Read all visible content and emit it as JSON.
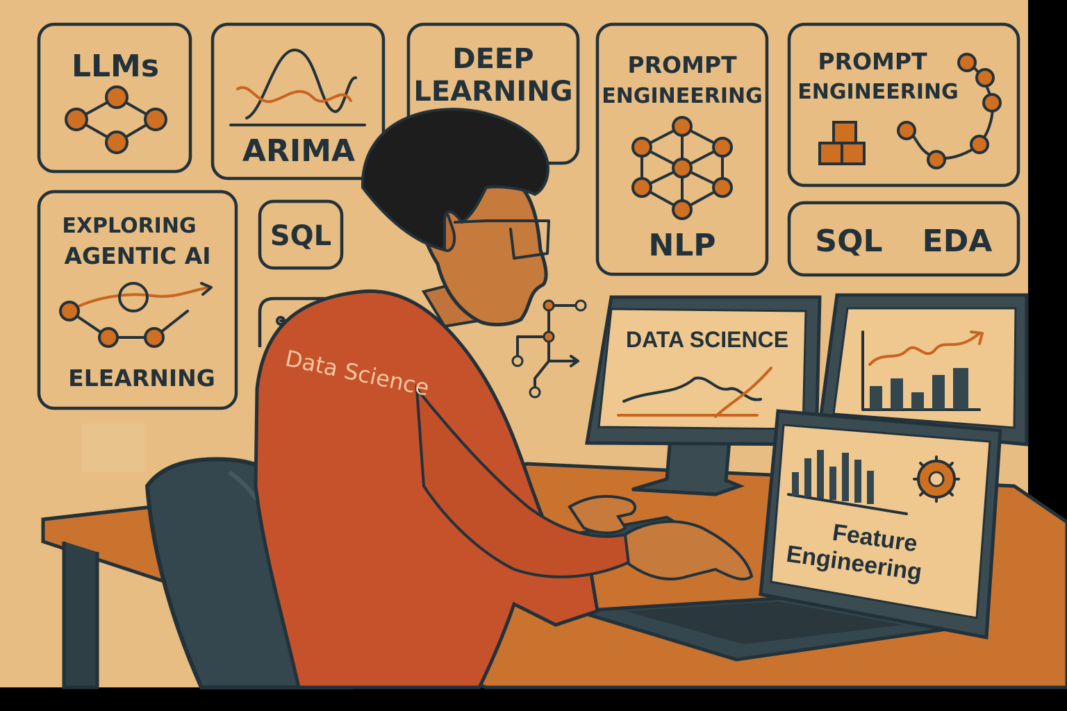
{
  "cards": {
    "llms": "LLMs",
    "arima": "ARIMA",
    "deep_learning_1": "DEEP",
    "deep_learning_2": "LEARNING",
    "prompt_eng_a_1": "PROMPT",
    "prompt_eng_a_2": "ENGINEERING",
    "nlp": "NLP",
    "prompt_eng_b_1": "PROMPT",
    "prompt_eng_b_2": "ENGINEERING",
    "exploring_1": "EXPLORING",
    "exploring_2": "AGENTIC AI",
    "elearning": "ELEARNING",
    "sql_small": "SQL",
    "sql_eda_1": "SQL",
    "sql_eda_2": "EDA"
  },
  "shirt_text": "Data Science",
  "monitor_left_title": "DATA SCIENCE",
  "laptop_title_1": "Feature",
  "laptop_title_2": "Engineering",
  "colors": {
    "background": "#e9bf84",
    "ink": "#23323a",
    "accent": "#cf6f22",
    "shirt": "#c5522a",
    "chair": "#34474e",
    "desk": "#c9732f"
  }
}
